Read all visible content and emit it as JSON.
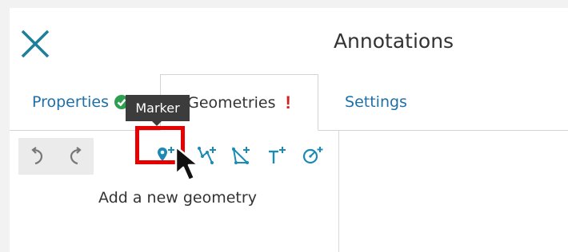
{
  "header": {
    "title": "Annotations",
    "close_icon": "close-icon"
  },
  "tabs": [
    {
      "label": "Properties",
      "status_icon": "check-circle-icon",
      "active": false
    },
    {
      "label": "Geometries",
      "status": "!",
      "active": true
    },
    {
      "label": "Settings",
      "active": false
    }
  ],
  "toolbar": {
    "undo_icon": "undo-icon",
    "redo_icon": "redo-icon",
    "tools": [
      {
        "icon": "marker-add-icon",
        "tooltip": "Marker",
        "highlighted": true
      },
      {
        "icon": "polyline-add-icon"
      },
      {
        "icon": "polygon-add-icon"
      },
      {
        "icon": "text-add-icon"
      },
      {
        "icon": "circle-add-icon"
      }
    ]
  },
  "tooltip": {
    "text": "Marker"
  },
  "empty_state": {
    "message": "Add a new geometry"
  },
  "colors": {
    "accent": "#1f6fa8",
    "icon_teal": "#1b8bb5",
    "close_teal": "#1d7f99",
    "warning": "#d61f1f",
    "success": "#2e9e4f",
    "highlight": "#e60000"
  }
}
